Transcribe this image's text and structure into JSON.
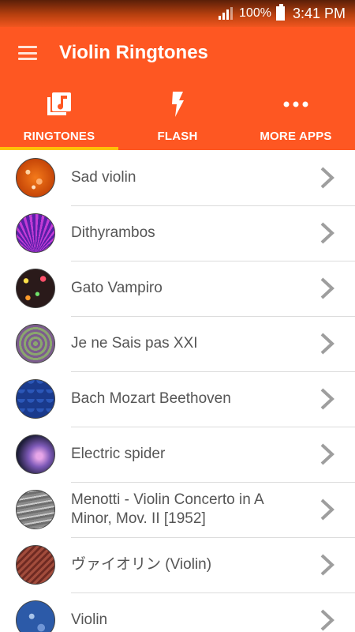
{
  "status_bar": {
    "battery": "100%",
    "time": "3:41 PM"
  },
  "app_bar": {
    "title": "Violin Ringtones"
  },
  "tabs": [
    {
      "label": "RINGTONES",
      "icon": "music-note-icon",
      "active": true
    },
    {
      "label": "FLASH",
      "icon": "flash-icon",
      "active": false
    },
    {
      "label": "MORE APPS",
      "icon": "more-dots-icon",
      "active": false
    }
  ],
  "colors": {
    "primary": "#fe5722",
    "tab_indicator": "#ffc107",
    "list_text": "#555555",
    "chevron": "#9e9e9e"
  },
  "ringtones": [
    {
      "title": "Sad violin"
    },
    {
      "title": "Dithyrambos"
    },
    {
      "title": "Gato Vampiro"
    },
    {
      "title": "Je ne Sais pas XXI"
    },
    {
      "title": "Bach Mozart Beethoven"
    },
    {
      "title": "Electric spider"
    },
    {
      "title": "Menotti - Violin Concerto in A Minor, Mov. II [1952]"
    },
    {
      "title": "ヴァイオリン (Violin)"
    },
    {
      "title": "Violin"
    }
  ]
}
